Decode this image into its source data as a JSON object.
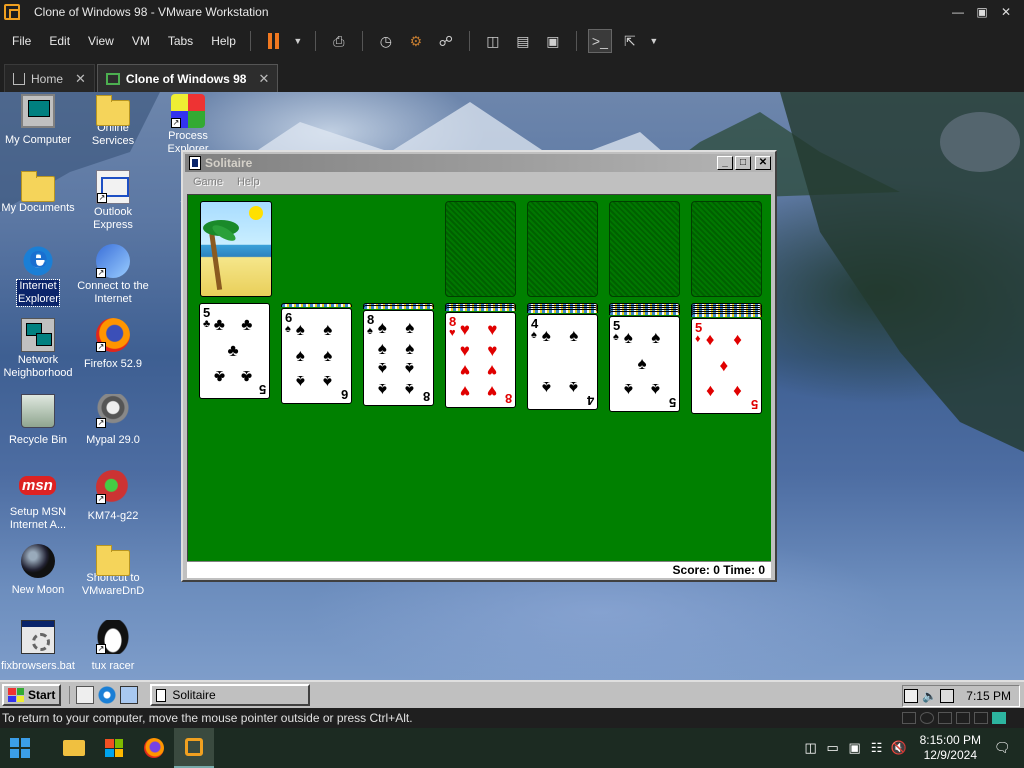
{
  "vmware": {
    "window_title": "Clone of Windows 98 - VMware Workstation",
    "menus": [
      {
        "label": "File"
      },
      {
        "label": "Edit"
      },
      {
        "label": "View"
      },
      {
        "label": "VM"
      },
      {
        "label": "Tabs"
      },
      {
        "label": "Help"
      }
    ],
    "tabs": [
      {
        "label": "Home"
      },
      {
        "label": "Clone of Windows 98"
      }
    ],
    "status_message": "To return to your computer, move the mouse pointer outside or press Ctrl+Alt.",
    "colors": {
      "pause": "#f07820",
      "chrome": "#1f1f1f"
    }
  },
  "desktop": {
    "icons": [
      {
        "label": "My Computer",
        "icon": "computer-icon"
      },
      {
        "label": "Online Services",
        "icon": "folder-icon"
      },
      {
        "label": "Process Explorer",
        "icon": "process-explorer-icon"
      },
      {
        "label": "My Documents",
        "icon": "folder-icon"
      },
      {
        "label": "Outlook Express",
        "icon": "outlook-icon"
      },
      {
        "label": "Internet Explorer",
        "icon": "ie-icon"
      },
      {
        "label": "Connect to the Internet",
        "icon": "connect-icon"
      },
      {
        "label": "Network Neighborhood",
        "icon": "network-icon"
      },
      {
        "label": "Firefox 52.9",
        "icon": "firefox-icon"
      },
      {
        "label": "Recycle Bin",
        "icon": "recycle-bin-icon"
      },
      {
        "label": "Mypal 29.0",
        "icon": "mypal-icon"
      },
      {
        "label": "Setup MSN Internet A...",
        "icon": "msn-icon"
      },
      {
        "label": "KM74-g22",
        "icon": "km-icon"
      },
      {
        "label": "New Moon",
        "icon": "new-moon-icon"
      },
      {
        "label": "Shortcut to VMwareDnD",
        "icon": "folder-icon"
      },
      {
        "label": "fixbrowsers.bat",
        "icon": "batch-file-icon"
      },
      {
        "label": "tux racer",
        "icon": "tux-icon"
      }
    ]
  },
  "solitaire": {
    "title": "Solitaire",
    "menus": [
      {
        "label": "Game"
      },
      {
        "label": "Help"
      }
    ],
    "status": "Score: 0 Time: 0",
    "felt_color": "#008000",
    "tableau": [
      {
        "rank": "5",
        "suit": "♣",
        "color": "black",
        "hidden": 0
      },
      {
        "rank": "6",
        "suit": "♠",
        "color": "black",
        "hidden": 1
      },
      {
        "rank": "8",
        "suit": "♠",
        "color": "black",
        "hidden": 2
      },
      {
        "rank": "8",
        "suit": "♥",
        "color": "red",
        "hidden": 3
      },
      {
        "rank": "4",
        "suit": "♠",
        "color": "black",
        "hidden": 4
      },
      {
        "rank": "5",
        "suit": "♠",
        "color": "black",
        "hidden": 5
      },
      {
        "rank": "5",
        "suit": "♦",
        "color": "red",
        "hidden": 6
      }
    ]
  },
  "guest_taskbar": {
    "start_label": "Start",
    "task_label": "Solitaire",
    "clock": "7:15 PM"
  },
  "host_taskbar": {
    "time": "8:15:00 PM",
    "date": "12/9/2024"
  }
}
